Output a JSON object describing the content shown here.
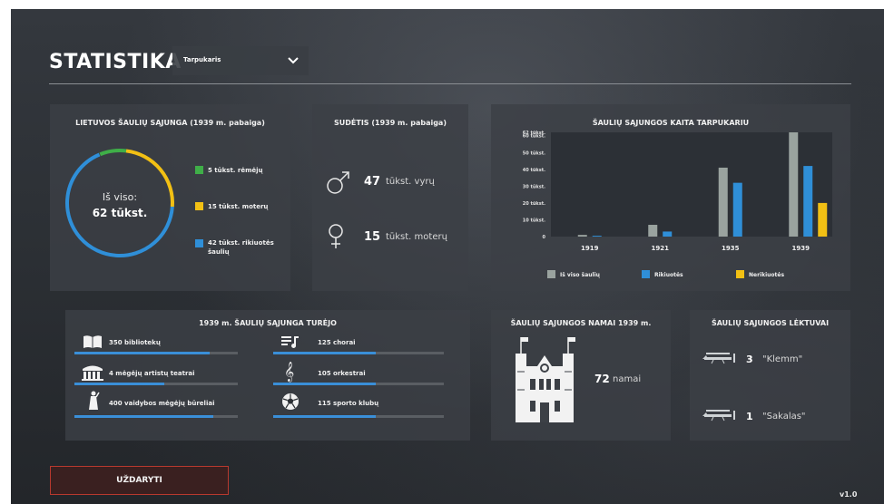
{
  "header": {
    "title": "STATISTIKA",
    "period_select": {
      "value": "Tarpukaris"
    }
  },
  "membership": {
    "heading": "LIETUVOS ŠAULIŲ SĄJUNGA (1939 m. pabaiga)",
    "total_label": "Iš viso:",
    "total_value": "62 tūkst.",
    "legend": [
      {
        "label": "5 tūkst. rėmėjų",
        "color": "#3fae48",
        "value": 5
      },
      {
        "label": "15 tūkst. moterų",
        "color": "#f2c014",
        "value": 15
      },
      {
        "label": "42 tūkst. rikiuotės šaulių",
        "color": "#2f8fd8",
        "value": 42
      }
    ]
  },
  "composition": {
    "heading": "SUDĖTIS (1939 m. pabaiga)",
    "men": {
      "number": "47",
      "text": "tūkst. vyrų",
      "icon": "male-icon"
    },
    "women": {
      "number": "15",
      "text": "tūkst. moterų",
      "icon": "female-icon"
    }
  },
  "chart_data": {
    "type": "bar",
    "title": "ŠAULIŲ SĄJUNGOS KAITA TARPUKARIU",
    "categories": [
      "1919",
      "1921",
      "1935",
      "1939"
    ],
    "y_ticks": [
      "62 tūkst.",
      "60 tūkst.",
      "50 tūkst.",
      "40 tūkst.",
      "30 tūkst.",
      "20 tūkst.",
      "10 tūkst.",
      "0"
    ],
    "ylim": [
      0,
      62
    ],
    "series": [
      {
        "name": "Iš viso šaulių",
        "color": "#9aa39f",
        "values": [
          1,
          7,
          41,
          62
        ]
      },
      {
        "name": "Rikiuotės",
        "color": "#2f8fd8",
        "values": [
          0.5,
          3,
          32,
          42
        ]
      },
      {
        "name": "Nerikiuotės",
        "color": "#f2c014",
        "values": [
          0,
          0,
          0,
          20
        ]
      }
    ],
    "legend_position": "bottom"
  },
  "assets": {
    "heading": "1939 m. ŠAULIŲ SĄJUNGA TURĖJO",
    "items": [
      {
        "text": "350 bibliotekų",
        "icon": "book-icon",
        "progress": 0.83
      },
      {
        "text": "125 chorai",
        "icon": "music-icon",
        "progress": 0.6
      },
      {
        "text": "4 mėgėjų artistų teatrai",
        "icon": "theatre-icon",
        "progress": 0.55
      },
      {
        "text": "105 orkestrai",
        "icon": "treble-clef-icon",
        "progress": 0.6
      },
      {
        "text": "400 vaidybos mėgėjų būreliai",
        "icon": "actor-icon",
        "progress": 0.85
      },
      {
        "text": "115 sporto klubų",
        "icon": "football-icon",
        "progress": 0.6
      }
    ]
  },
  "houses": {
    "heading": "ŠAULIŲ SĄJUNGOS NAMAI 1939 m.",
    "number": "72",
    "text": "namai"
  },
  "planes": {
    "heading": "ŠAULIŲ SĄJUNGOS LĖKTUVAI",
    "items": [
      {
        "number": "3",
        "name": "\"Klemm\""
      },
      {
        "number": "1",
        "name": "\"Sakalas\""
      }
    ]
  },
  "footer": {
    "close_label": "UŽDARYTI",
    "version": "v1.0"
  }
}
